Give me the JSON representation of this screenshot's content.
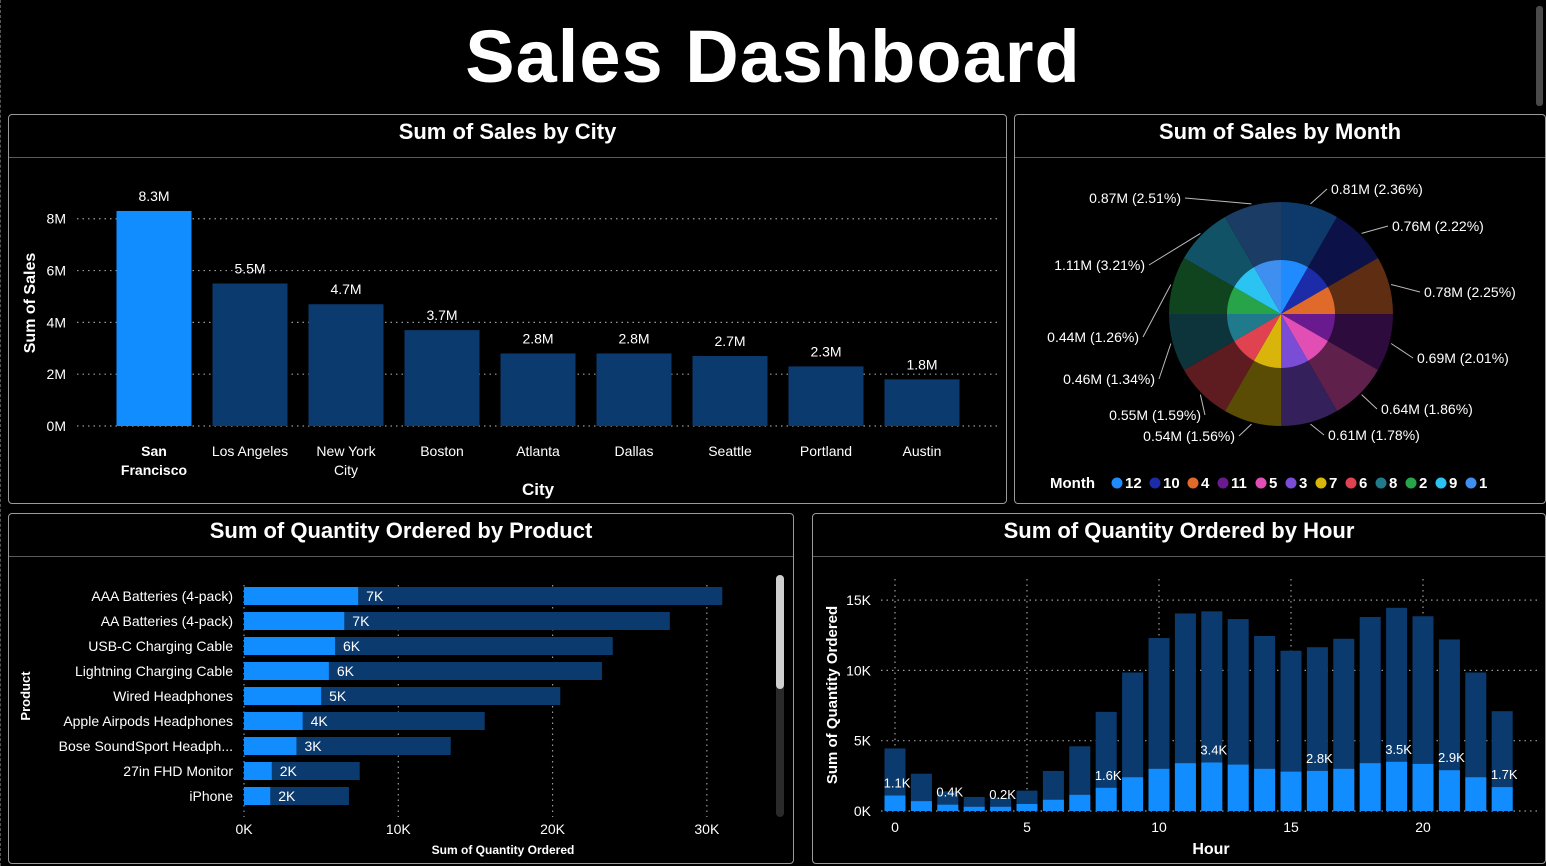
{
  "dashboard": {
    "title": "Sales Dashboard"
  },
  "colors": {
    "highlight": "#118DFF",
    "base": "#0B3A6E",
    "grid": "#9a9a9a"
  },
  "chart_data": [
    {
      "id": "city",
      "type": "bar",
      "title": "Sum of Sales by City",
      "xlabel": "City",
      "ylabel": "Sum of Sales",
      "ylim": [
        0,
        8.8
      ],
      "yticks": [
        "0M",
        "2M",
        "4M",
        "6M",
        "8M"
      ],
      "categories": [
        "San Francisco",
        "Los Angeles",
        "New York City",
        "Boston",
        "Atlanta",
        "Dallas",
        "Seattle",
        "Portland",
        "Austin"
      ],
      "values": [
        8.3,
        5.5,
        4.7,
        3.7,
        2.8,
        2.8,
        2.7,
        2.3,
        1.8
      ],
      "labels": [
        "8.3M",
        "5.5M",
        "4.7M",
        "3.7M",
        "2.8M",
        "2.8M",
        "2.7M",
        "2.3M",
        "1.8M"
      ],
      "highlighted": "San Francisco",
      "grid": true
    },
    {
      "id": "month",
      "type": "pie",
      "title": "Sum of Sales by Month",
      "legend_title": "Month",
      "legend_position": "bottom",
      "months": [
        "12",
        "10",
        "4",
        "11",
        "5",
        "3",
        "7",
        "6",
        "8",
        "2",
        "9",
        "1"
      ],
      "slice_colors": [
        "#1F8BFF",
        "#1C2BA8",
        "#E06A2A",
        "#6A1A8F",
        "#E24FB4",
        "#7B4CD6",
        "#D9B50C",
        "#E0424F",
        "#1F7A8C",
        "#27A34A",
        "#2AC3F2",
        "#3E8FF0"
      ],
      "labels": [
        "0.81M (2.36%)",
        "0.76M (2.22%)",
        "0.78M (2.25%)",
        "0.69M (2.01%)",
        "0.64M (1.86%)",
        "0.61M (1.78%)",
        "0.54M (1.56%)",
        "0.55M (1.59%)",
        "0.46M (1.34%)",
        "0.44M (1.26%)",
        "1.11M (3.21%)",
        "0.87M (2.51%)"
      ]
    },
    {
      "id": "product",
      "type": "bar",
      "orientation": "horizontal",
      "title": "Sum of Quantity Ordered by Product",
      "xlabel": "Sum of Quantity Ordered",
      "ylabel": "Product",
      "xlim": [
        0,
        35000
      ],
      "xticks": [
        "0K",
        "10K",
        "20K",
        "30K"
      ],
      "categories": [
        "AAA Batteries (4-pack)",
        "AA Batteries (4-pack)",
        "USB-C Charging Cable",
        "Lightning Charging Cable",
        "Wired Headphones",
        "Apple Airpods Headphones",
        "Bose SoundSport Headph...",
        "27in FHD Monitor",
        "iPhone"
      ],
      "values": [
        7400,
        6500,
        5900,
        5500,
        5000,
        3800,
        3400,
        1800,
        1700
      ],
      "totals": [
        31000,
        27600,
        23900,
        23200,
        20500,
        15600,
        13400,
        7500,
        6800
      ],
      "labels": [
        "7K",
        "7K",
        "6K",
        "6K",
        "5K",
        "4K",
        "3K",
        "2K",
        "2K"
      ],
      "grid": true
    },
    {
      "id": "hour",
      "type": "bar",
      "title": "Sum of Quantity Ordered by Hour",
      "xlabel": "Hour",
      "ylabel": "Sum of Quantity Ordered",
      "ylim": [
        0,
        16500
      ],
      "yticks": [
        "0K",
        "5K",
        "10K",
        "15K"
      ],
      "xticks": [
        "0",
        "5",
        "10",
        "15",
        "20"
      ],
      "x": [
        0,
        1,
        2,
        3,
        4,
        5,
        6,
        7,
        8,
        9,
        10,
        11,
        12,
        13,
        14,
        15,
        16,
        17,
        18,
        19,
        20,
        21,
        22,
        23
      ],
      "values": [
        1100,
        700,
        450,
        300,
        300,
        500,
        800,
        1150,
        1650,
        2400,
        3000,
        3400,
        3450,
        3300,
        3000,
        2800,
        2850,
        3000,
        3400,
        3500,
        3350,
        2900,
        2400,
        1700
      ],
      "totals": [
        4450,
        2650,
        1400,
        1000,
        950,
        1450,
        2850,
        4600,
        7050,
        9850,
        12300,
        14050,
        14200,
        13650,
        12450,
        11400,
        11650,
        12250,
        13800,
        14450,
        13850,
        12200,
        9850,
        7100
      ],
      "labels": [
        "1.1K",
        "",
        "0.4K",
        "",
        "0.2K",
        "",
        "",
        "",
        "1.6K",
        "",
        "",
        "",
        "3.4K",
        "",
        "",
        "",
        "2.8K",
        "",
        "",
        "3.5K",
        "",
        "2.9K",
        "",
        "1.7K"
      ],
      "grid": true
    }
  ]
}
